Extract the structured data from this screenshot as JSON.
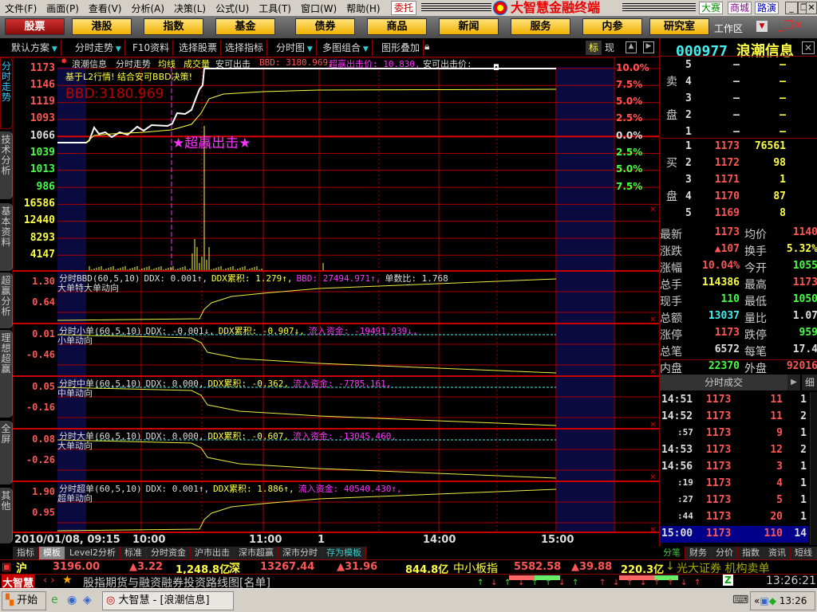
{
  "menu": [
    "文件(F)",
    "画面(P)",
    "查看(V)",
    "分析(A)",
    "决策(L)",
    "公式(U)",
    "工具(T)",
    "窗口(W)",
    "帮助(H)"
  ],
  "entrust": "委托",
  "app_title": "大智慧金融终端",
  "top_links": [
    "大赛",
    "商城",
    "路演"
  ],
  "nav": [
    "股票",
    "港股",
    "指数",
    "基金",
    "债券",
    "商品",
    "新闻",
    "服务",
    "内参",
    "研究室"
  ],
  "workspace": "工作区",
  "toolbar": [
    "默认方案",
    "分时走势",
    "F10资料",
    "选择股票",
    "选择指标",
    "分时图",
    "多图组合",
    "图形叠加"
  ],
  "toolbar_right": [
    "标",
    "现"
  ],
  "stock": {
    "code": "000977",
    "name": "浪潮信息"
  },
  "left_tabs": [
    "分时走势",
    "技术分析",
    "基本资料",
    "超赢分析",
    "理想超赢",
    "全屏",
    "其他"
  ],
  "main_chart": {
    "header": [
      "浪潮信息",
      "分时走势",
      "均线",
      "成交量",
      "安可出击",
      "BBD: 3180.969,",
      "超赢出击价: 10.830,",
      "安可出击价:"
    ],
    "note": "基于L2行情! 结合安可BBD决策!",
    "bbd": "BBD:3180.969",
    "signal": "★超赢出击★",
    "price_ticks": [
      "1173",
      "1146",
      "1119",
      "1093",
      "1066",
      "1039",
      "1013",
      "986"
    ],
    "pct_ticks": [
      "10.0%",
      "7.5%",
      "5.0%",
      "2.5%",
      "0.0%",
      "2.5%",
      "5.0%",
      "7.5%"
    ],
    "vol_ticks": [
      "16586",
      "12440",
      "8293",
      "4147"
    ]
  },
  "panels": [
    {
      "title": "分时BBD(60,5,10)",
      "a": "DDX: 0.001↑,",
      "b": "DDX累积: 1.279↑,",
      "c": "BBD: 27494.971↑,",
      "d": "单数比: 1.768",
      "sub": "大单特大单动向",
      "ticks": [
        "1.30",
        "0.64"
      ]
    },
    {
      "title": "分时小单(60,5,10)",
      "a": "DDX: -0.001↓,",
      "b": "DDX累积: -0.907↓,",
      "c": "流入资金: -19491.939↓,",
      "d": "",
      "sub": "小单动向",
      "ticks": [
        "0.01",
        "-0.46"
      ]
    },
    {
      "title": "分时中单(60,5,10)",
      "a": "DDX: 0.000,",
      "b": "DDX累积: -0.362,",
      "c": "流入资金: -7785.161,",
      "d": "",
      "sub": "中单动向",
      "ticks": [
        "0.05",
        "-0.16"
      ]
    },
    {
      "title": "分时大单(60,5,10)",
      "a": "DDX: 0.000,",
      "b": "DDX累积: -0.607,",
      "c": "流入资金: -13045.460,",
      "d": "",
      "sub": "大单动向",
      "ticks": [
        "0.08",
        "-0.26"
      ]
    },
    {
      "title": "分时超单(60,5,10)",
      "a": "DDX: 0.001↑,",
      "b": "DDX累积: 1.886↑,",
      "c": "流入资金: 40540.430↑,",
      "d": "",
      "sub": "超单动向",
      "ticks": [
        "1.90",
        "0.95"
      ]
    }
  ],
  "time_axis": [
    "2010/01/08, 09:15",
    "10:00",
    "11:00",
    "1",
    "14:00",
    "15:00"
  ],
  "orderbook": {
    "sell_label": [
      "卖",
      "盘"
    ],
    "buy_label": [
      "买",
      "盘"
    ],
    "sell": [
      {
        "n": "5",
        "p": "—",
        "v": "—"
      },
      {
        "n": "4",
        "p": "—",
        "v": "—"
      },
      {
        "n": "3",
        "p": "—",
        "v": "—"
      },
      {
        "n": "2",
        "p": "—",
        "v": "—"
      },
      {
        "n": "1",
        "p": "—",
        "v": "—"
      }
    ],
    "buy": [
      {
        "n": "1",
        "p": "1173",
        "v": "76561"
      },
      {
        "n": "2",
        "p": "1172",
        "v": "98"
      },
      {
        "n": "3",
        "p": "1171",
        "v": "1"
      },
      {
        "n": "4",
        "p": "1170",
        "v": "87"
      },
      {
        "n": "5",
        "p": "1169",
        "v": "8"
      }
    ]
  },
  "quote": [
    [
      "最新",
      "1173",
      "red",
      "均价",
      "1140",
      "red"
    ],
    [
      "涨跌",
      "▲107",
      "red",
      "换手",
      "5.32%",
      "yel"
    ],
    [
      "涨幅",
      "10.04%",
      "red",
      "今开",
      "1055",
      "grn"
    ],
    [
      "总手",
      "114386",
      "yel",
      "最高",
      "1173",
      "red"
    ],
    [
      "现手",
      "110",
      "grn",
      "最低",
      "1050",
      "grn"
    ],
    [
      "总额",
      "13037",
      "cyn",
      "量比",
      "1.07",
      "wht"
    ],
    [
      "涨停",
      "1173",
      "red",
      "跌停",
      "959",
      "grn"
    ],
    [
      "总笔",
      "6572",
      "wht",
      "每笔",
      "17.4",
      "wht"
    ],
    [
      "内盘",
      "22370",
      "grn",
      "外盘",
      "92016",
      "red"
    ]
  ],
  "ticks_title": "分时成交",
  "ticks_detail": "细",
  "ticks": [
    [
      "14:51",
      "1173",
      "11",
      "1"
    ],
    [
      "14:52",
      "1173",
      "11",
      "2"
    ],
    [
      ":57",
      "1173",
      "9",
      "1"
    ],
    [
      "14:53",
      "1173",
      "12",
      "2"
    ],
    [
      "14:56",
      "1173",
      "3",
      "1"
    ],
    [
      ":19",
      "1173",
      "4",
      "1"
    ],
    [
      ":27",
      "1173",
      "5",
      "1"
    ],
    [
      ":44",
      "1173",
      "20",
      "1"
    ],
    [
      "15:00",
      "1173",
      "110",
      "14"
    ]
  ],
  "bottom_tabs": [
    "指标",
    "模板",
    "Level2分析",
    "标准",
    "分时资金",
    "沪市出击",
    "深市超赢",
    "深市分时",
    "存为模板"
  ],
  "right_tabs": [
    "分笔",
    "财务",
    "分价",
    "指数",
    "资讯",
    "短线"
  ],
  "index_bar": {
    "sh": "沪",
    "sh_val": "3196.00",
    "sh_chg": "▲3.22",
    "sh_amt": "1,248.8亿",
    "sz": "深",
    "sz_val": "13267.44",
    "sz_chg": "▲31.96",
    "sz_amt": "844.8亿",
    "sme": "中小板指",
    "sme_val": "5582.58",
    "sme_chg": "▲39.88",
    "sme_amt": "220.3亿",
    "ticker": "光大证券 机构卖单"
  },
  "news": {
    "brand": "大智慧",
    "headline": "股指期货与融资融券投资路线图[名单]",
    "time": "13:26:21"
  },
  "taskbar": {
    "start": "开始",
    "window": "大智慧 - [浪潮信息]",
    "clock": "13:26"
  }
}
